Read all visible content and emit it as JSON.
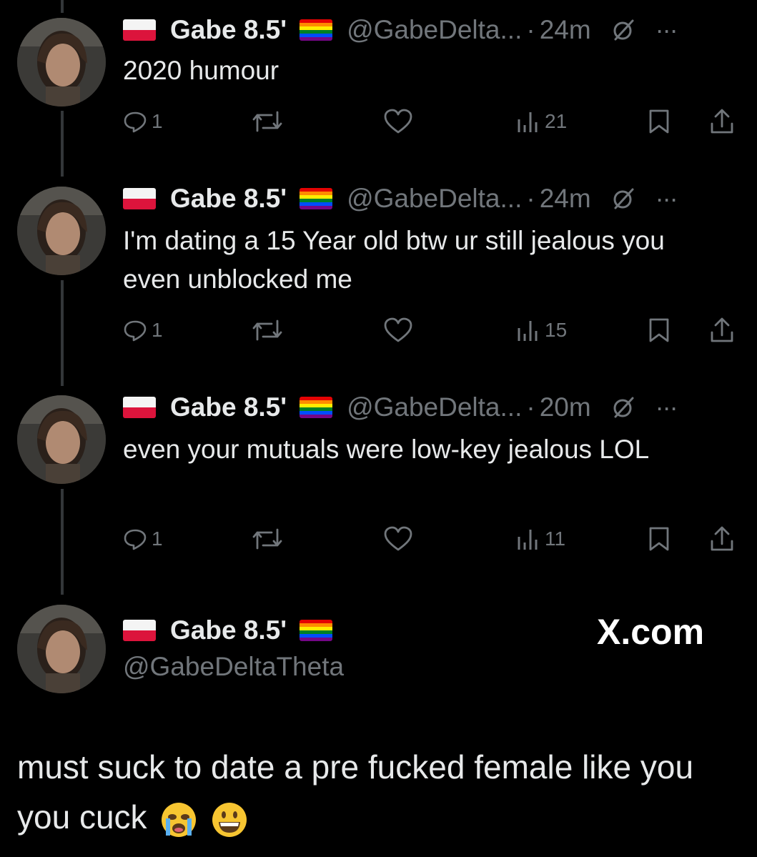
{
  "colors": {
    "background": "#000000",
    "text": "#e7e9ea",
    "muted": "#71767b",
    "thread_line": "#333639"
  },
  "tweets": [
    {
      "name": "Gabe 8.5'",
      "handle": "@GabeDelta...",
      "dot": "·",
      "time": "24m",
      "text": "2020 humour",
      "replies": "1",
      "views": "21",
      "more": "···"
    },
    {
      "name": "Gabe 8.5'",
      "handle": "@GabeDelta...",
      "dot": "·",
      "time": "24m",
      "text": "I'm dating a 15 Year old btw ur still jealous you even unblocked me",
      "replies": "1",
      "views": "15",
      "more": "···"
    },
    {
      "name": "Gabe 8.5'",
      "handle": "@GabeDelta...",
      "dot": "·",
      "time": "20m",
      "text": "even your mutuals were low-key jealous LOL",
      "replies": "1",
      "views": "11",
      "more": "···"
    }
  ],
  "main_tweet": {
    "name": "Gabe 8.5'",
    "handle": "@GabeDeltaTheta",
    "watermark": "X.com",
    "text": "must suck to date a pre fucked female like you you cuck"
  },
  "icons": [
    "poland-flag-icon",
    "rainbow-flag-icon",
    "grok-icon",
    "more-icon",
    "reply-icon",
    "retweet-icon",
    "like-icon",
    "views-icon",
    "bookmark-icon",
    "share-icon",
    "crying-face-emoji",
    "grinning-face-emoji"
  ]
}
